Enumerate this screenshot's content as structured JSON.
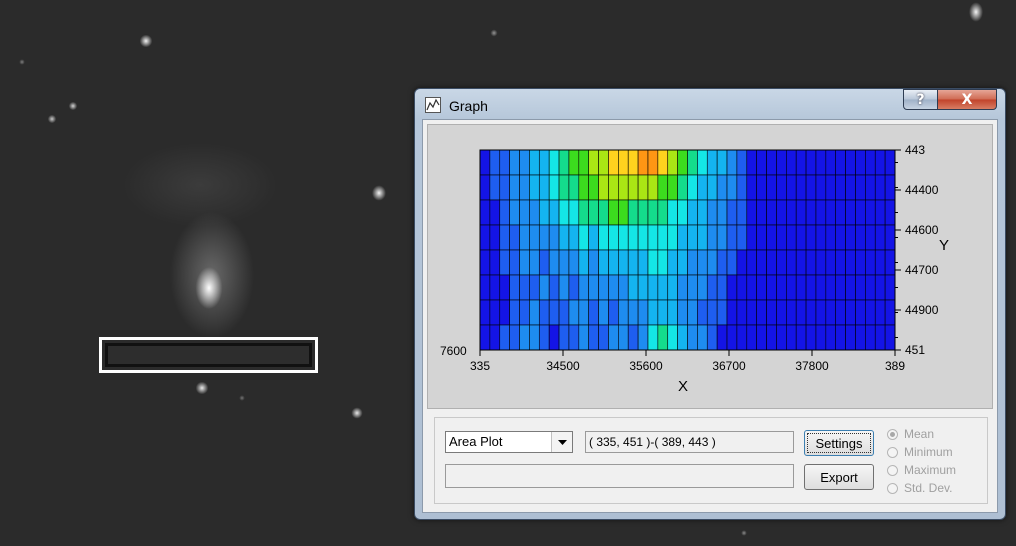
{
  "window": {
    "title": "Graph",
    "help_label": "?",
    "close_label": "X"
  },
  "chart_data": {
    "type": "heatmap",
    "x_ticks": [
      "335",
      "34500",
      "35600",
      "36700",
      "37800",
      "389"
    ],
    "y_ticks": [
      "443",
      "44400",
      "44600",
      "44700",
      "44900",
      "451"
    ],
    "left_label": "7600",
    "xlabel": "X",
    "ylabel": "Y",
    "columns": 42,
    "rows": 8,
    "levels": [
      [
        0,
        1,
        1,
        2,
        2,
        3,
        3,
        4,
        5,
        6,
        6,
        7,
        7,
        8,
        8,
        8,
        9,
        9,
        8,
        7,
        6,
        5,
        4,
        3,
        3,
        2,
        1,
        0,
        0,
        0,
        0,
        0,
        0,
        0,
        0,
        0,
        0,
        0,
        0,
        0,
        0,
        0
      ],
      [
        0,
        1,
        1,
        2,
        2,
        3,
        3,
        4,
        5,
        5,
        6,
        6,
        7,
        7,
        7,
        7,
        7,
        7,
        6,
        6,
        5,
        4,
        3,
        3,
        2,
        2,
        1,
        0,
        0,
        0,
        0,
        0,
        0,
        0,
        0,
        0,
        0,
        0,
        0,
        0,
        0,
        0
      ],
      [
        0,
        0,
        1,
        2,
        2,
        2,
        3,
        3,
        4,
        4,
        5,
        5,
        5,
        6,
        6,
        5,
        5,
        5,
        5,
        4,
        4,
        3,
        3,
        2,
        2,
        1,
        1,
        0,
        0,
        0,
        0,
        0,
        0,
        0,
        0,
        0,
        0,
        0,
        0,
        0,
        0,
        0
      ],
      [
        0,
        0,
        1,
        1,
        2,
        2,
        2,
        2,
        3,
        3,
        4,
        3,
        4,
        4,
        4,
        4,
        4,
        4,
        4,
        4,
        3,
        3,
        3,
        2,
        2,
        1,
        1,
        0,
        0,
        0,
        0,
        0,
        0,
        0,
        0,
        0,
        0,
        0,
        0,
        0,
        0,
        0
      ],
      [
        0,
        0,
        1,
        1,
        2,
        2,
        1,
        2,
        2,
        2,
        3,
        2,
        3,
        3,
        3,
        3,
        3,
        4,
        4,
        3,
        3,
        2,
        2,
        2,
        1,
        1,
        0,
        0,
        0,
        0,
        0,
        0,
        0,
        0,
        0,
        0,
        0,
        0,
        0,
        0,
        0,
        0
      ],
      [
        0,
        0,
        0,
        1,
        1,
        1,
        2,
        1,
        2,
        1,
        2,
        2,
        2,
        2,
        2,
        3,
        3,
        3,
        3,
        3,
        2,
        2,
        2,
        1,
        1,
        0,
        0,
        0,
        0,
        0,
        0,
        0,
        0,
        0,
        0,
        0,
        0,
        0,
        0,
        0,
        0,
        0
      ],
      [
        0,
        0,
        0,
        1,
        1,
        2,
        1,
        1,
        1,
        2,
        2,
        1,
        2,
        1,
        2,
        2,
        2,
        3,
        3,
        3,
        2,
        2,
        1,
        1,
        1,
        0,
        0,
        0,
        0,
        0,
        0,
        0,
        0,
        0,
        0,
        0,
        0,
        0,
        0,
        0,
        0,
        0
      ],
      [
        0,
        0,
        1,
        1,
        2,
        2,
        1,
        0,
        1,
        1,
        2,
        1,
        1,
        2,
        2,
        1,
        2,
        4,
        5,
        4,
        3,
        2,
        2,
        1,
        0,
        0,
        0,
        0,
        0,
        0,
        0,
        0,
        0,
        0,
        0,
        0,
        0,
        0,
        0,
        0,
        0,
        0
      ]
    ],
    "palette": [
      "#1414e6",
      "#1e5ef0",
      "#1e8cf0",
      "#14b4f0",
      "#14e6e6",
      "#14dc8c",
      "#3cdc1e",
      "#aae614",
      "#ffd21e",
      "#ff9614"
    ]
  },
  "controls": {
    "plot_type": "Area Plot",
    "coordinates": "( 335, 451 )-( 389, 443 )",
    "status_text": "",
    "settings_label": "Settings",
    "export_label": "Export",
    "radios": [
      {
        "label": "Mean",
        "checked": true
      },
      {
        "label": "Minimum",
        "checked": false
      },
      {
        "label": "Maximum",
        "checked": false
      },
      {
        "label": "Std. Dev.",
        "checked": false
      }
    ]
  }
}
